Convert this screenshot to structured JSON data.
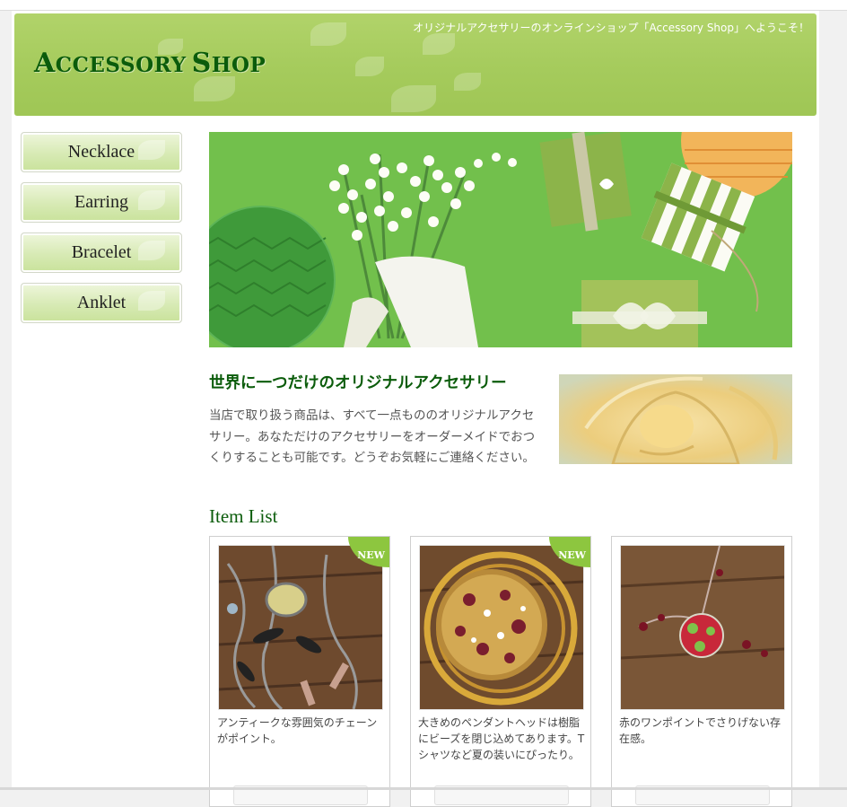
{
  "header": {
    "welcome": "オリジナルアクセサリーのオンラインショップ「Accessory Shop」へようこそ！",
    "logo_a": "A",
    "logo_ccessory": "CCESSORY",
    "logo_s": "S",
    "logo_hop": "HOP"
  },
  "nav": {
    "items": [
      {
        "label": "Necklace"
      },
      {
        "label": "Earring"
      },
      {
        "label": "Bracelet"
      },
      {
        "label": "Anklet"
      }
    ]
  },
  "intro": {
    "title": "世界に一つだけのオリジナルアクセサリー",
    "text": "当店で取り扱う商品は、すべて一点もののオリジナルアクセサリー。あなただけのアクセサリーをオーダーメイドでおつくりすることも可能です。どうぞお気軽にご連絡ください。"
  },
  "items": {
    "title": "Item List",
    "list": [
      {
        "caption": "アンティークな雰囲気のチェーンがポイント。",
        "badge": "NEW"
      },
      {
        "caption": "大きめのペンダントヘッドは樹脂にビーズを閉じ込めてあります。Tシャツなど夏の装いにぴったり。",
        "badge": "NEW"
      },
      {
        "caption": "赤のワンポイントでさりげない存在感。",
        "badge": ""
      }
    ]
  },
  "colors": {
    "header_green": "#a5cb5c",
    "title_green": "#0b5c0b",
    "badge_green": "#8dc63f"
  }
}
